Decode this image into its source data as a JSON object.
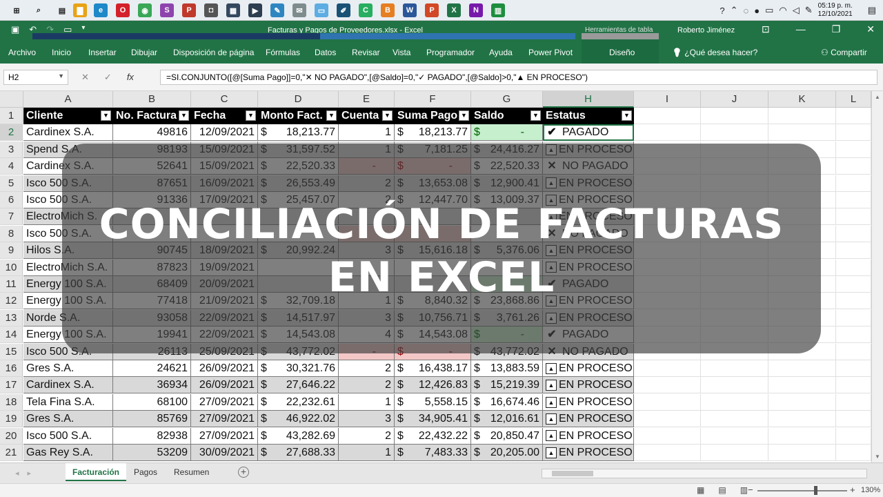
{
  "taskbar": {
    "apps": [
      {
        "icon": "windows-start-icon",
        "color": "#1f1f1f",
        "glyph": "⊞"
      },
      {
        "icon": "search-icon",
        "color": "#1f1f1f",
        "glyph": "⌕"
      },
      {
        "icon": "task-view-icon",
        "color": "#1f1f1f",
        "glyph": "▤"
      },
      {
        "icon": "file-explorer-icon",
        "color": "#e8a317",
        "glyph": "▇"
      },
      {
        "icon": "edge-icon",
        "color": "#1e88c8",
        "glyph": "e"
      },
      {
        "icon": "opera-icon",
        "color": "#d4202a",
        "glyph": "O"
      },
      {
        "icon": "chrome-icon",
        "color": "#3aa757",
        "glyph": "◉"
      },
      {
        "icon": "stripe-app-icon",
        "color": "#8e44ad",
        "glyph": "S"
      },
      {
        "icon": "pdf-app-icon",
        "color": "#c0392b",
        "glyph": "P"
      },
      {
        "icon": "camera-icon",
        "color": "#555555",
        "glyph": "◘"
      },
      {
        "icon": "calculator-icon",
        "color": "#34495e",
        "glyph": "▦"
      },
      {
        "icon": "media-app-icon",
        "color": "#2c3e50",
        "glyph": "▶"
      },
      {
        "icon": "paint-icon",
        "color": "#2e86c1",
        "glyph": "✎"
      },
      {
        "icon": "feedback-icon",
        "color": "#7f8c8d",
        "glyph": "✉"
      },
      {
        "icon": "notes-icon",
        "color": "#5dade2",
        "glyph": "▭"
      },
      {
        "icon": "pen-app-icon",
        "color": "#1a5276",
        "glyph": "✐"
      },
      {
        "icon": "camtasia-icon",
        "color": "#27ae60",
        "glyph": "C"
      },
      {
        "icon": "brave-icon",
        "color": "#e67e22",
        "glyph": "B"
      },
      {
        "icon": "word-icon",
        "color": "#2b579a",
        "glyph": "W"
      },
      {
        "icon": "powerpoint-icon",
        "color": "#d24726",
        "glyph": "P"
      },
      {
        "icon": "excel-icon",
        "color": "#217346",
        "glyph": "X"
      },
      {
        "icon": "onenote-icon",
        "color": "#7719aa",
        "glyph": "N"
      },
      {
        "icon": "sheets-icon",
        "color": "#1e8e3e",
        "glyph": "▥"
      }
    ],
    "time": "05:19 p. m.",
    "date": "12/10/2021"
  },
  "window": {
    "title": "Facturas y Pagos de Proveedores.xlsx  -  Excel",
    "context_tab": "Herramientas de tabla",
    "user": "Roberto Jiménez"
  },
  "ribbon": {
    "tabs": [
      "Archivo",
      "Inicio",
      "Insertar",
      "Dibujar",
      "Disposición de página",
      "Fórmulas",
      "Datos",
      "Revisar",
      "Vista",
      "Programador",
      "Ayuda",
      "Power Pivot",
      "Diseño"
    ],
    "search": "¿Qué desea hacer?",
    "share": "Compartir"
  },
  "formula_bar": {
    "name_box": "H2",
    "formula": "=SI.CONJUNTO([@[Suma Pago]]=0,\"✕ NO PAGADO\",[@Saldo]=0,\"✓ PAGADO\",[@Saldo]>0,\"▲ EN PROCESO\")"
  },
  "columns": [
    "A",
    "B",
    "C",
    "D",
    "E",
    "F",
    "G",
    "H",
    "I",
    "J",
    "K",
    "L"
  ],
  "table": {
    "headers": [
      "Cliente",
      "No. Factura",
      "Fecha",
      "Monto Fact.",
      "Cuenta",
      "Suma Pago",
      "Saldo",
      "Estatus"
    ],
    "rows": [
      {
        "n": "2",
        "cliente": "Cardinex S.A.",
        "factura": "49816",
        "fecha": "12/09/2021",
        "monto": "18,213.77",
        "cuenta": "1",
        "pago": "18,213.77",
        "saldo": "-",
        "status": "paid",
        "estatus": "PAGADO"
      },
      {
        "n": "3",
        "cliente": "Spend S.A.",
        "factura": "98193",
        "fecha": "15/09/2021",
        "monto": "31,597.52",
        "cuenta": "1",
        "pago": "7,181.25",
        "saldo": "24,416.27",
        "status": "process",
        "estatus": "EN PROCESO"
      },
      {
        "n": "4",
        "cliente": "Cardinex S.A.",
        "factura": "52641",
        "fecha": "15/09/2021",
        "monto": "22,520.33",
        "cuenta": "-",
        "pago": "-",
        "saldo": "22,520.33",
        "status": "unpaid",
        "estatus": "NO PAGADO"
      },
      {
        "n": "5",
        "cliente": "Isco 500 S.A.",
        "factura": "87651",
        "fecha": "16/09/2021",
        "monto": "26,553.49",
        "cuenta": "2",
        "pago": "13,653.08",
        "saldo": "12,900.41",
        "status": "process",
        "estatus": "EN PROCESO"
      },
      {
        "n": "6",
        "cliente": "Isco 500 S.A.",
        "factura": "91336",
        "fecha": "17/09/2021",
        "monto": "25,457.07",
        "cuenta": "2",
        "pago": "12,447.70",
        "saldo": "13,009.37",
        "status": "process",
        "estatus": "EN PROCESO"
      },
      {
        "n": "7",
        "cliente": "ElectroMich S.",
        "factura": "",
        "fecha": "",
        "monto": "",
        "cuenta": "",
        "pago": "",
        "saldo": "",
        "status": "process",
        "estatus": "EN PROCESO"
      },
      {
        "n": "8",
        "cliente": "Isco 500 S.A.",
        "factura": "",
        "fecha": "",
        "monto": "",
        "cuenta": "",
        "pago": "",
        "saldo": "",
        "status": "unpaid",
        "estatus": "NO PAGADO"
      },
      {
        "n": "9",
        "cliente": "Hilos S.A.",
        "factura": "90745",
        "fecha": "18/09/2021",
        "monto": "20,992.24",
        "cuenta": "3",
        "pago": "15,616.18",
        "saldo": "5,376.06",
        "status": "process",
        "estatus": "EN PROCESO"
      },
      {
        "n": "10",
        "cliente": "ElectroMich S.A.",
        "factura": "87823",
        "fecha": "19/09/2021",
        "monto": "",
        "cuenta": "",
        "pago": "",
        "saldo": "",
        "status": "process",
        "estatus": "EN PROCESO"
      },
      {
        "n": "11",
        "cliente": "Energy 100 S.A.",
        "factura": "68409",
        "fecha": "20/09/2021",
        "monto": "",
        "cuenta": "",
        "pago": "",
        "saldo": "",
        "status": "paid",
        "estatus": "PAGADO"
      },
      {
        "n": "12",
        "cliente": "Energy 100 S.A.",
        "factura": "77418",
        "fecha": "21/09/2021",
        "monto": "32,709.18",
        "cuenta": "1",
        "pago": "8,840.32",
        "saldo": "23,868.86",
        "status": "process",
        "estatus": "EN PROCESO"
      },
      {
        "n": "13",
        "cliente": "Norde S.A.",
        "factura": "93058",
        "fecha": "22/09/2021",
        "monto": "14,517.97",
        "cuenta": "3",
        "pago": "10,756.71",
        "saldo": "3,761.26",
        "status": "process",
        "estatus": "EN PROCESO"
      },
      {
        "n": "14",
        "cliente": "Energy 100 S.A.",
        "factura": "19941",
        "fecha": "22/09/2021",
        "monto": "14,543.08",
        "cuenta": "4",
        "pago": "14,543.08",
        "saldo": "-",
        "status": "paid",
        "estatus": "PAGADO"
      },
      {
        "n": "15",
        "cliente": "Isco 500 S.A.",
        "factura": "26113",
        "fecha": "25/09/2021",
        "monto": "43,772.02",
        "cuenta": "-",
        "pago": "-",
        "saldo": "43,772.02",
        "status": "unpaid",
        "estatus": "NO PAGADO"
      },
      {
        "n": "16",
        "cliente": "Gres S.A.",
        "factura": "24621",
        "fecha": "26/09/2021",
        "monto": "30,321.76",
        "cuenta": "2",
        "pago": "16,438.17",
        "saldo": "13,883.59",
        "status": "process",
        "estatus": "EN PROCESO"
      },
      {
        "n": "17",
        "cliente": "Cardinex S.A.",
        "factura": "36934",
        "fecha": "26/09/2021",
        "monto": "27,646.22",
        "cuenta": "2",
        "pago": "12,426.83",
        "saldo": "15,219.39",
        "status": "process",
        "estatus": "EN PROCESO"
      },
      {
        "n": "18",
        "cliente": "Tela Fina S.A.",
        "factura": "68100",
        "fecha": "27/09/2021",
        "monto": "22,232.61",
        "cuenta": "1",
        "pago": "5,558.15",
        "saldo": "16,674.46",
        "status": "process",
        "estatus": "EN PROCESO"
      },
      {
        "n": "19",
        "cliente": "Gres S.A.",
        "factura": "85769",
        "fecha": "27/09/2021",
        "monto": "46,922.02",
        "cuenta": "3",
        "pago": "34,905.41",
        "saldo": "12,016.61",
        "status": "process",
        "estatus": "EN PROCESO"
      },
      {
        "n": "20",
        "cliente": "Isco 500 S.A.",
        "factura": "82938",
        "fecha": "27/09/2021",
        "monto": "43,282.69",
        "cuenta": "2",
        "pago": "22,432.22",
        "saldo": "20,850.47",
        "status": "process",
        "estatus": "EN PROCESO"
      },
      {
        "n": "21",
        "cliente": "Gas Rey S.A.",
        "factura": "53209",
        "fecha": "30/09/2021",
        "monto": "27,688.33",
        "cuenta": "1",
        "pago": "7,483.33",
        "saldo": "20,205.00",
        "status": "process",
        "estatus": "EN PROCESO"
      }
    ]
  },
  "currency_symbol": "$",
  "overlay": {
    "line1": "CONCILIACIÓN DE FACTURAS",
    "line2": "EN EXCEL"
  },
  "sheets": [
    "Facturación",
    "Pagos",
    "Resumen"
  ],
  "active_sheet": "Facturación",
  "status_bar": {
    "zoom": "130%"
  },
  "colors": {
    "excel_green": "#217346",
    "paid_fill": "#c6efce",
    "unpaid_fill": "#f4c7c7",
    "band_fill": "#d9d9d9"
  }
}
